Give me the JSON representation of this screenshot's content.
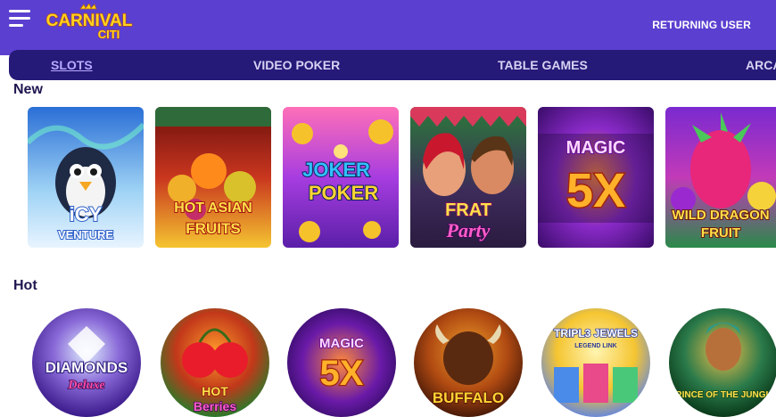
{
  "header": {
    "returning_user": "RETURNING USER",
    "logo_text": "CARNIVAL CITI"
  },
  "tabs": [
    {
      "label": "SLOTS",
      "active": true
    },
    {
      "label": "VIDEO POKER",
      "active": false
    },
    {
      "label": "TABLE GAMES",
      "active": false
    },
    {
      "label": "ARCA",
      "active": false
    }
  ],
  "sections": {
    "new": {
      "title": "New",
      "games": [
        {
          "line1": "iCY",
          "line2": "VENTURE"
        },
        {
          "line1": "HOT ASIAN",
          "line2": "FRUITS"
        },
        {
          "line1": "JOKER",
          "line2": "POKER"
        },
        {
          "line1": "FRAT",
          "line2": "Party"
        },
        {
          "line1": "MAGIC",
          "line2": "5X"
        },
        {
          "line1": "WILD DRAGON",
          "line2": "FRUIT"
        }
      ]
    },
    "hot": {
      "title": "Hot",
      "games": [
        {
          "line1": "DIAMONDS",
          "line2": "Deluxe"
        },
        {
          "line1": "HOT",
          "line2": "Berries"
        },
        {
          "line1": "MAGIC",
          "line2": "5X"
        },
        {
          "line1": "BUFFALO",
          "line2": ""
        },
        {
          "line1": "TRIPL3 JEWELS",
          "line2": "LEGEND LINK"
        },
        {
          "line1": "PRINCE OF THE JUNGLE",
          "line2": ""
        }
      ]
    }
  },
  "colors": {
    "header_bg": "#5b3fd0",
    "tabs_bg": "#251a78",
    "logo_yellow": "#ffd21f"
  }
}
